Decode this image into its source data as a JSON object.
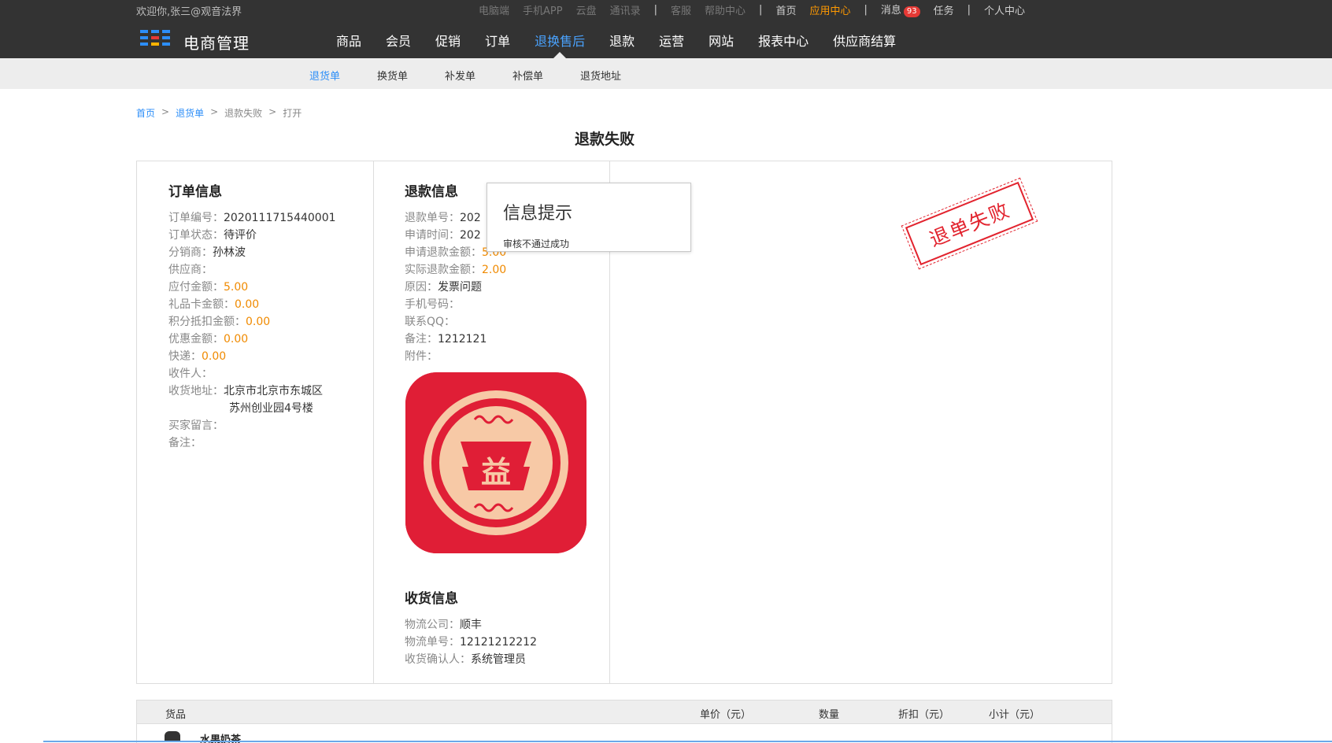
{
  "topbar": {
    "welcome": "欢迎你,张三@观音法界",
    "links": {
      "pc": "电脑端",
      "mobile_app": "手机APP",
      "cloud": "云盘",
      "contacts": "通讯录",
      "service": "客服",
      "help": "帮助中心",
      "home": "首页",
      "app_center": "应用中心",
      "messages": "消息",
      "messages_count": "93",
      "tasks": "任务",
      "profile": "个人中心"
    },
    "separator": "|"
  },
  "brand": {
    "name": "电商管理",
    "logo_colors": [
      "#2c8ef8",
      "#e53935",
      "#ffb300"
    ]
  },
  "mainnav": {
    "items": [
      {
        "label": "商品"
      },
      {
        "label": "会员"
      },
      {
        "label": "促销"
      },
      {
        "label": "订单"
      },
      {
        "label": "退换售后"
      },
      {
        "label": "退款"
      },
      {
        "label": "运营"
      },
      {
        "label": "网站"
      },
      {
        "label": "报表中心"
      },
      {
        "label": "供应商结算"
      }
    ],
    "active": "退换售后"
  },
  "subnav": {
    "items": [
      {
        "label": "退货单"
      },
      {
        "label": "换货单"
      },
      {
        "label": "补发单"
      },
      {
        "label": "补偿单"
      },
      {
        "label": "退货地址"
      }
    ],
    "active": "退货单"
  },
  "breadcrumb": {
    "items": [
      "首页",
      "退货单",
      "退款失败",
      "打开"
    ],
    "separator": ">"
  },
  "page_title": "退款失败",
  "order_info": {
    "title": "订单信息",
    "order_no_label": "订单编号：",
    "order_no": "2020111715440001",
    "status_label": "订单状态：",
    "status": "待评价",
    "distributor_label": "分销商：",
    "distributor": "孙林波",
    "supplier_label": "供应商：",
    "supplier": "",
    "payable_label": "应付金额：",
    "payable": "5.00",
    "giftcard_label": "礼品卡金额：",
    "giftcard": "0.00",
    "points_label": "积分抵扣金额：",
    "points": "0.00",
    "discount_label": "优惠金额：",
    "discount": "0.00",
    "express_label": "快递：",
    "express": "0.00",
    "receiver_label": "收件人：",
    "receiver": "",
    "address_label": "收货地址：",
    "address_line1": "北京市北京市东城区",
    "address_line2": "苏州创业园4号楼",
    "buyer_msg_label": "买家留言：",
    "buyer_msg": "",
    "remark_label": "备注：",
    "remark": ""
  },
  "refund_info": {
    "title": "退款信息",
    "refund_no_label": "退款单号：",
    "refund_no_partial": "202",
    "apply_time_label": "申请时间：",
    "apply_time_partial": "202",
    "apply_amount_label": "申请退款金额：",
    "apply_amount_partial": "5.00",
    "actual_amount_label": "实际退款金额：",
    "actual_amount": "2.00",
    "reason_label": "原因：",
    "reason": "发票问题",
    "phone_label": "手机号码：",
    "phone": "",
    "qq_label": "联系QQ：",
    "qq": "",
    "remark_label": "备注：",
    "remark": "1212121",
    "attachment_label": "附件：",
    "attachment_glyph": "益"
  },
  "shipping_info": {
    "title": "收货信息",
    "company_label": "物流公司：",
    "company": "顺丰",
    "tracking_label": "物流单号：",
    "tracking": "12121212212",
    "confirmer_label": "收货确认人：",
    "confirmer": "系统管理员"
  },
  "third_col": {
    "title_partial": "信息",
    "partial_mark": "："
  },
  "stamp": {
    "text": "退单失败",
    "color": "#e2232e"
  },
  "dialog": {
    "title": "信息提示",
    "message": "审核不通过成功"
  },
  "goods_table": {
    "columns": [
      "货品",
      "单价（元）",
      "数量",
      "折扣（元）",
      "小计（元）"
    ],
    "rows": [
      {
        "name": "水果奶茶"
      }
    ]
  },
  "colors": {
    "accent": "#2c8ef8",
    "money": "#f08a00",
    "topbar_bg": "#333333",
    "active_top": "#ff9900"
  }
}
